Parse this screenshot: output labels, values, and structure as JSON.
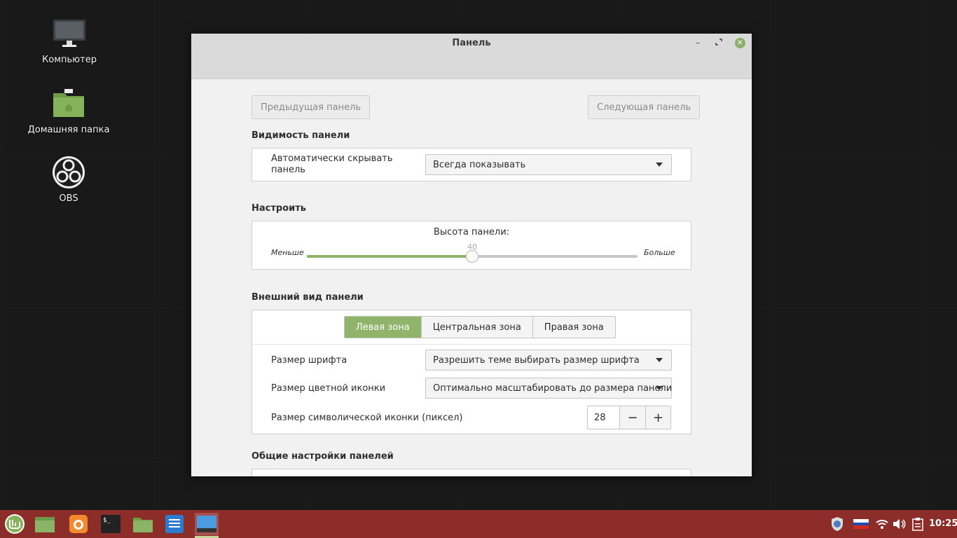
{
  "desktop": {
    "icons": [
      {
        "label": "Компьютер"
      },
      {
        "label": "Домашняя папка"
      },
      {
        "label": "OBS"
      }
    ]
  },
  "window": {
    "title": "Панель",
    "prev_panel": "Предыдущая панель",
    "next_panel": "Следующая панель",
    "visibility": {
      "title": "Видимость панели",
      "autohide_label": "Автоматически скрывать панель",
      "autohide_value": "Всегда показывать"
    },
    "customize": {
      "title": "Настроить",
      "height_label": "Высота панели:",
      "less": "Меньше",
      "more": "Больше",
      "height_value": "40",
      "height_fraction": 0.5
    },
    "appearance": {
      "title": "Внешний вид панели",
      "zones": [
        "Левая зона",
        "Центральная зона",
        "Правая зона"
      ],
      "active_zone": 0,
      "font_size_label": "Размер шрифта",
      "font_size_value": "Разрешить теме выбирать размер шрифта",
      "color_icon_label": "Размер цветной иконки",
      "color_icon_value": "Оптимально масштабировать до размера панели",
      "symbolic_icon_label": "Размер символической иконки (пиксел)",
      "symbolic_icon_value": "28"
    },
    "general": {
      "title": "Общие настройки панелей"
    }
  },
  "taskbar": {
    "clock": "10:25"
  },
  "colors": {
    "accent": "#8fb46a",
    "taskbar": "#8c2d2a"
  }
}
